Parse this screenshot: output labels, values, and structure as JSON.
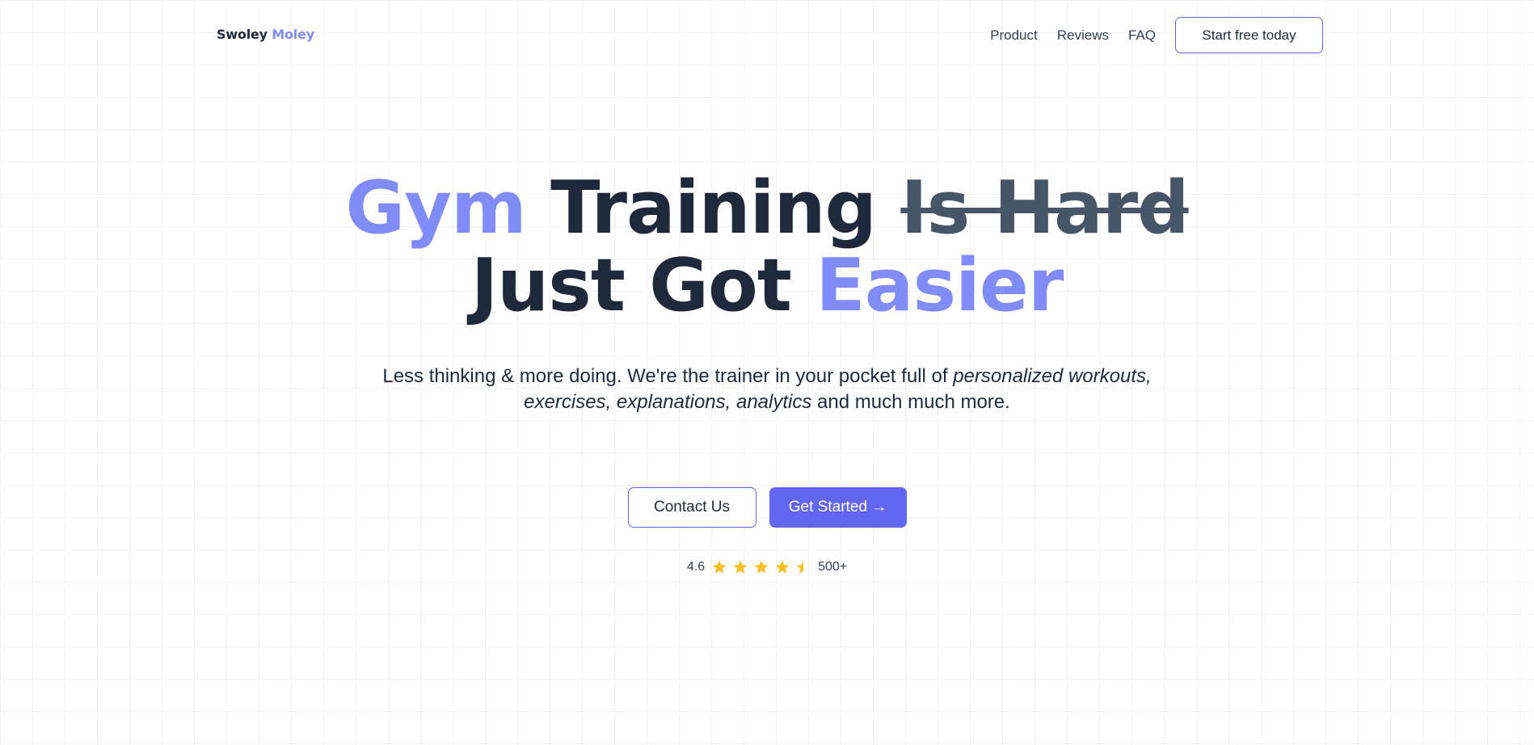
{
  "nav": {
    "logo_part1": "Swoley",
    "logo_part2": "Moley",
    "links": [
      "Product",
      "Reviews",
      "FAQ"
    ],
    "cta_label": "Start free today"
  },
  "hero": {
    "title_gym": "Gym",
    "title_training": "Training",
    "title_strike": "Is Hard",
    "title_just": "Just Got",
    "title_easier": "Easier",
    "subtitle_part1": "Less thinking & more doing. We're the trainer in your pocket full of",
    "subtitle_italic1": "personalized workouts,",
    "subtitle_italic2": "exercises, explanations, analytics",
    "subtitle_part2": "and much much more."
  },
  "buttons": {
    "contact_label": "Contact Us",
    "get_started_label": "Get Started →"
  },
  "rating": {
    "score": "4.6",
    "count": "500+",
    "stars": [
      1,
      1,
      1,
      1,
      0.5
    ],
    "star_color": "#fbbf24"
  },
  "colors": {
    "accent": "#818cf8",
    "primary": "#6366f1",
    "text_dark": "#1e293b"
  }
}
